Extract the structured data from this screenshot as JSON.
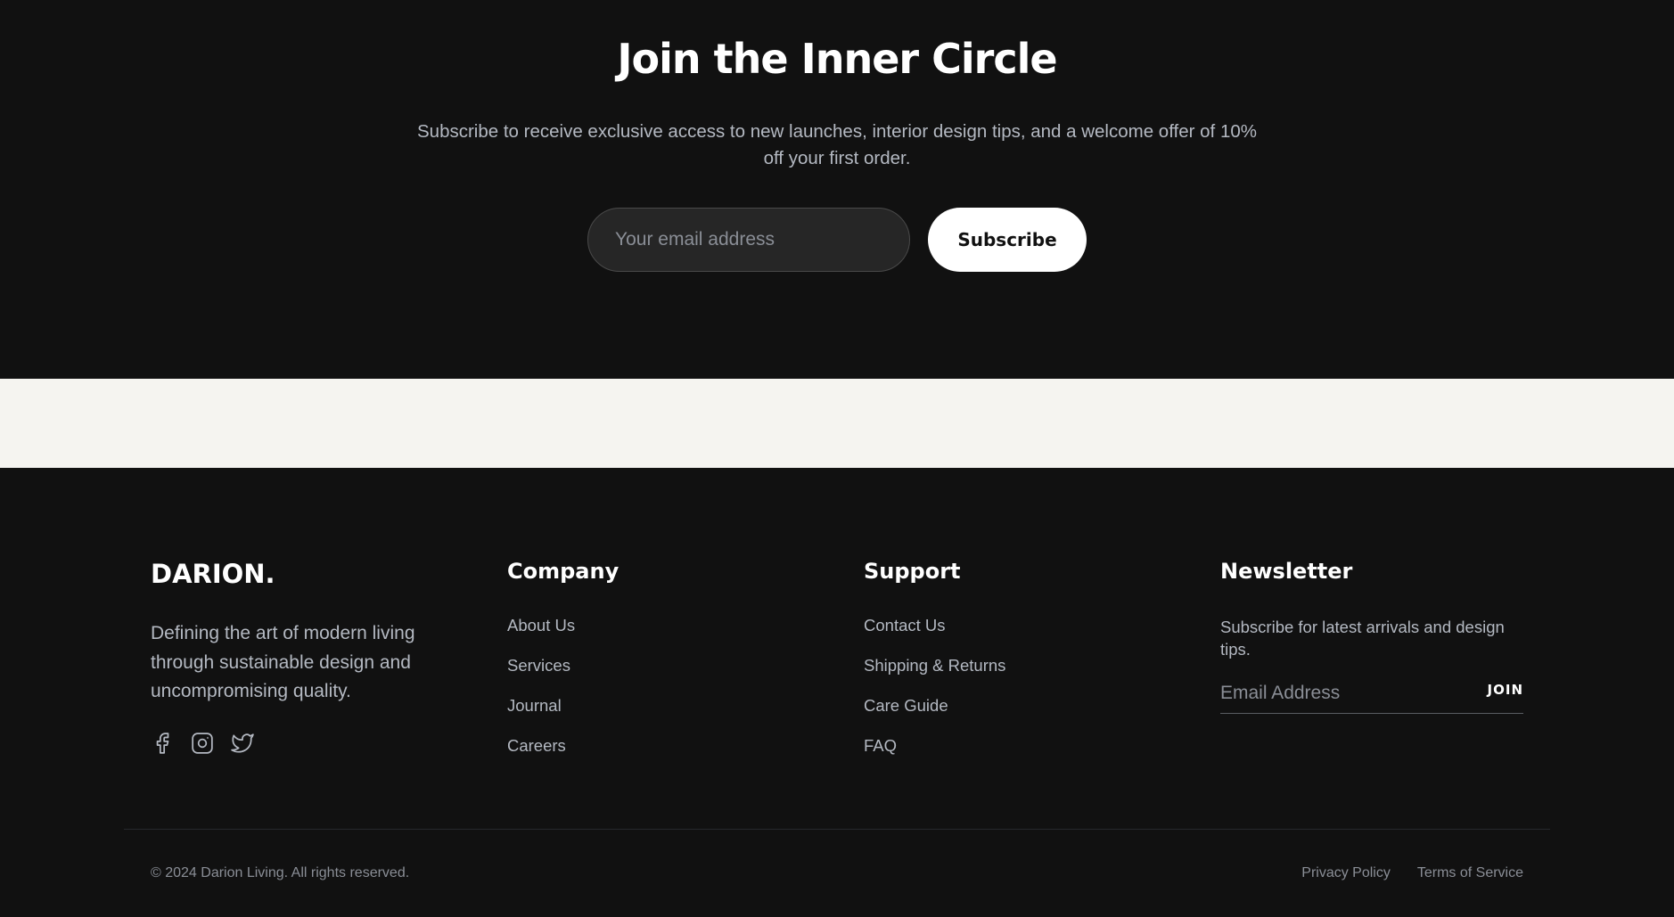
{
  "inner_circle": {
    "title": "Join the Inner Circle",
    "description": "Subscribe to receive exclusive access to new launches, interior design tips, and a welcome offer of 10% off your first order.",
    "email_placeholder": "Your email address",
    "email_value": "",
    "subscribe_label": "Subscribe"
  },
  "footer": {
    "brand": {
      "logo_text": "DARION.",
      "description": "Defining the art of modern living through sustainable design and uncompromising quality.",
      "socials": [
        {
          "icon": "facebook-icon"
        },
        {
          "icon": "instagram-icon"
        },
        {
          "icon": "twitter-icon"
        }
      ]
    },
    "company": {
      "heading": "Company",
      "links": [
        "About Us",
        "Services",
        "Journal",
        "Careers"
      ]
    },
    "support": {
      "heading": "Support",
      "links": [
        "Contact Us",
        "Shipping & Returns",
        "Care Guide",
        "FAQ"
      ]
    },
    "newsletter": {
      "heading": "Newsletter",
      "description": "Subscribe for latest arrivals and design tips.",
      "email_placeholder": "Email Address",
      "email_value": "",
      "join_label": "JOIN"
    },
    "copyright": "© 2024 Darion Living. All rights reserved.",
    "legal_links": [
      "Privacy Policy",
      "Terms of Service"
    ]
  },
  "colors": {
    "dark_background": "#111111",
    "cream_band": "#f5f4f0",
    "muted_text": "#b4b9c2",
    "white": "#ffffff"
  }
}
